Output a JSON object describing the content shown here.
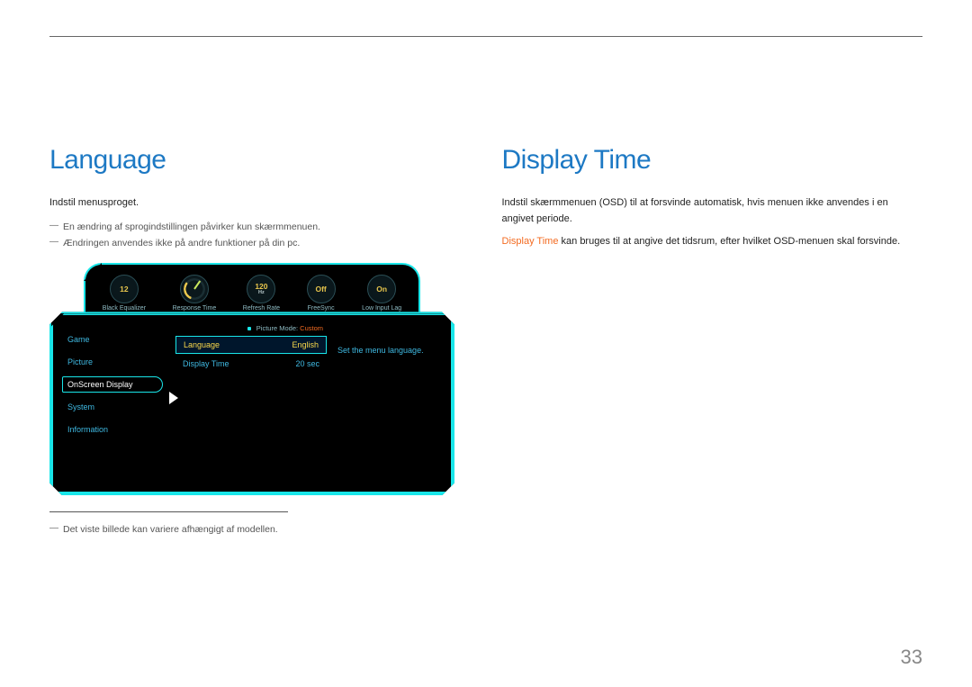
{
  "page_number": "33",
  "left": {
    "heading": "Language",
    "p1": "Indstil menusproget.",
    "fn1": "En ændring af sprogindstillingen påvirker kun skærmmenuen.",
    "fn2": "Ændringen anvendes ikke på andre funktioner på din pc.",
    "fn3": "Det viste billede kan variere afhængigt af modellen."
  },
  "right": {
    "heading": "Display Time",
    "p1": "Indstil skærmmenuen (OSD) til at forsvinde automatisk, hvis menuen ikke anvendes i en angivet periode.",
    "term": "Display Time",
    "p2_rest": " kan bruges til at angive det tidsrum, efter hvilket OSD-menuen skal forsvinde."
  },
  "osd": {
    "dials": [
      {
        "value": "12",
        "sub": "",
        "label": "Black Equalizer",
        "style": "yellow"
      },
      {
        "value": "",
        "sub": "",
        "label": "Response Time",
        "style": "gauge"
      },
      {
        "value": "120",
        "sub": "Hz",
        "label": "Refresh Rate",
        "style": "yellow"
      },
      {
        "value": "Off",
        "sub": "",
        "label": "FreeSync",
        "style": "yellow"
      },
      {
        "value": "On",
        "sub": "",
        "label": "Low Input Lag",
        "style": "yellow"
      }
    ],
    "picture_mode_label": "Picture Mode: ",
    "picture_mode_value": "Custom",
    "sidebar": [
      {
        "label": "Game",
        "active": false
      },
      {
        "label": "Picture",
        "active": false
      },
      {
        "label": "OnScreen Display",
        "active": true
      },
      {
        "label": "System",
        "active": false
      },
      {
        "label": "Information",
        "active": false
      }
    ],
    "options": [
      {
        "label": "Language",
        "value": "English",
        "highlight": true
      },
      {
        "label": "Display Time",
        "value": "20 sec",
        "highlight": false
      }
    ],
    "description": "Set the menu language."
  }
}
